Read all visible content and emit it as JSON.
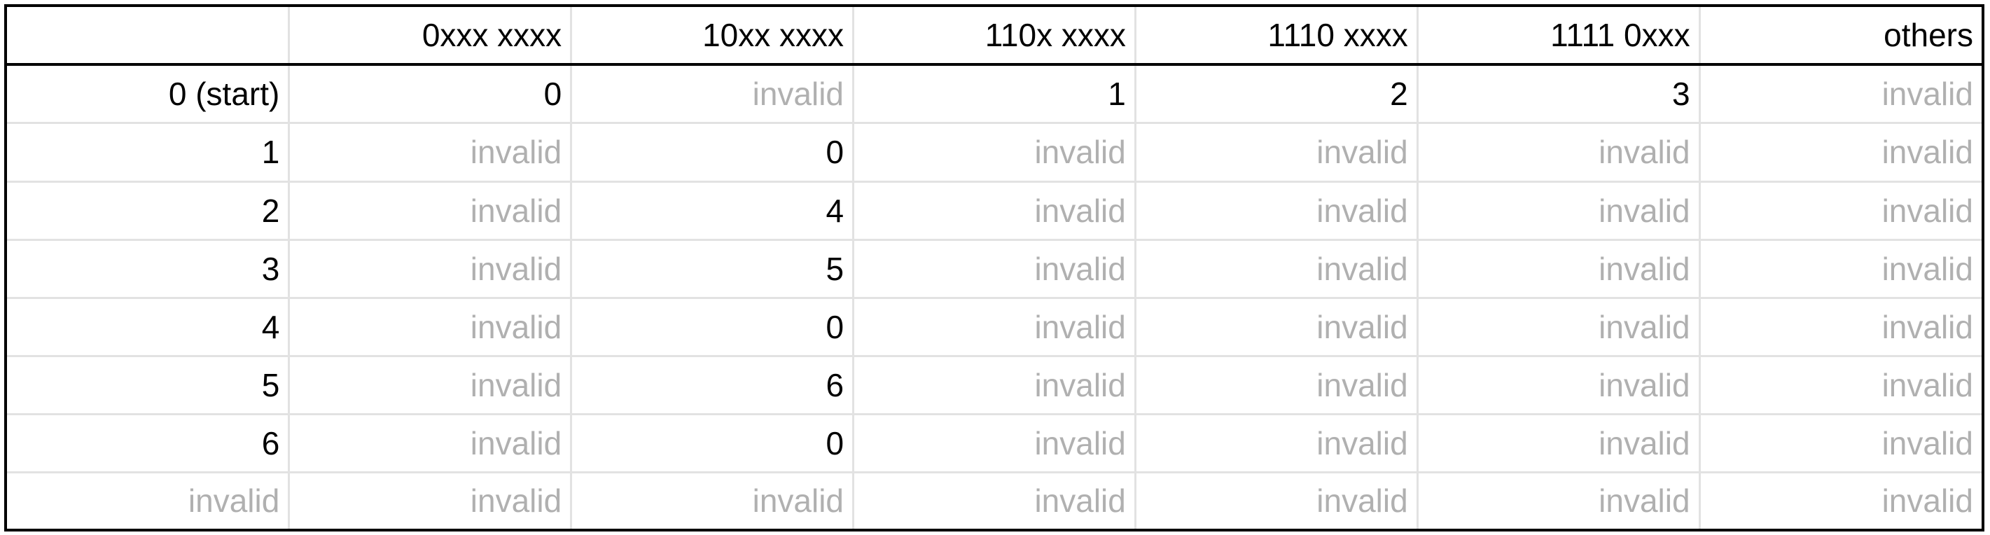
{
  "table": {
    "columns": [
      "",
      "0xxx xxxx",
      "10xx xxxx",
      "110x xxxx",
      "1110 xxxx",
      "1111 0xxx",
      "others"
    ],
    "rows": [
      [
        "0 (start)",
        "0",
        "invalid",
        "1",
        "2",
        "3",
        "invalid"
      ],
      [
        "1",
        "invalid",
        "0",
        "invalid",
        "invalid",
        "invalid",
        "invalid"
      ],
      [
        "2",
        "invalid",
        "4",
        "invalid",
        "invalid",
        "invalid",
        "invalid"
      ],
      [
        "3",
        "invalid",
        "5",
        "invalid",
        "invalid",
        "invalid",
        "invalid"
      ],
      [
        "4",
        "invalid",
        "0",
        "invalid",
        "invalid",
        "invalid",
        "invalid"
      ],
      [
        "5",
        "invalid",
        "6",
        "invalid",
        "invalid",
        "invalid",
        "invalid"
      ],
      [
        "6",
        "invalid",
        "0",
        "invalid",
        "invalid",
        "invalid",
        "invalid"
      ],
      [
        "invalid",
        "invalid",
        "invalid",
        "invalid",
        "invalid",
        "invalid",
        "invalid"
      ]
    ]
  },
  "colors": {
    "text": "#000000",
    "invalid_text": "#b0b0b0",
    "gridline": "#e2e2e2",
    "frame": "#000000"
  }
}
